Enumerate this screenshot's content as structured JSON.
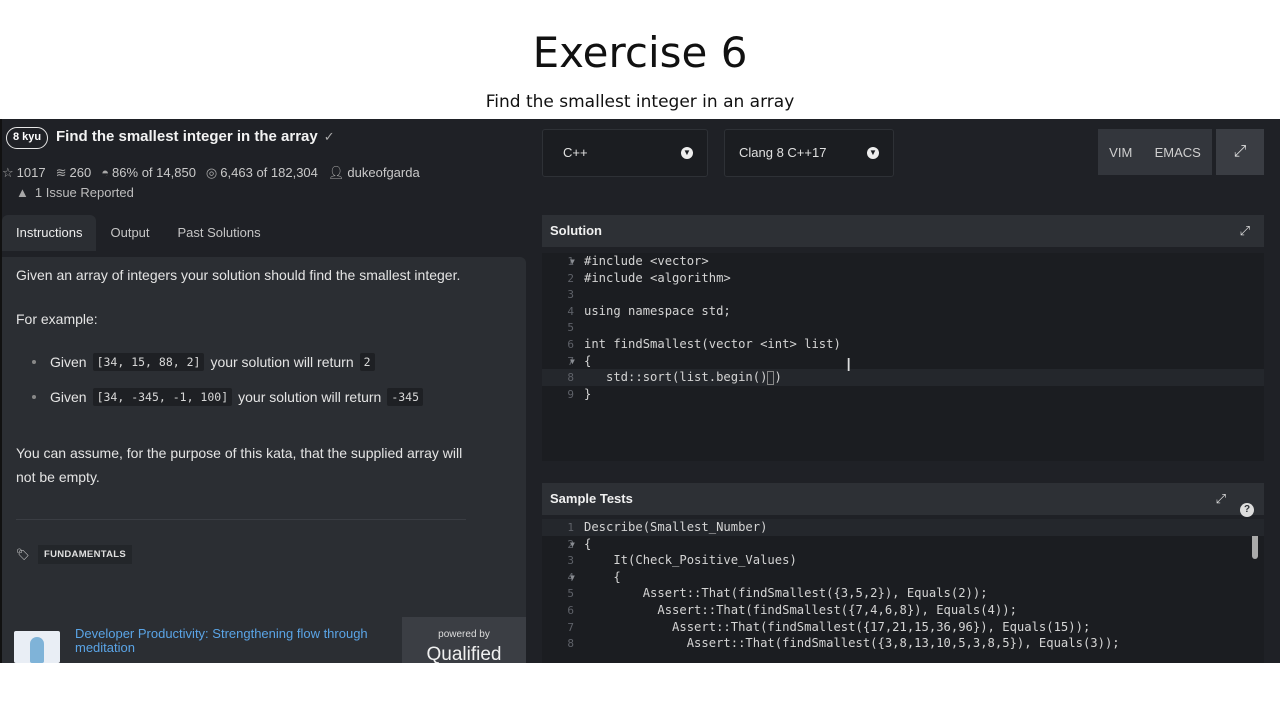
{
  "slide": {
    "title": "Exercise 6",
    "subtitle": "Find the smallest integer in an array"
  },
  "kata": {
    "rank": "8 kyu",
    "title": "Find the smallest integer in the array",
    "check": "✓",
    "stats": {
      "stars": "1017",
      "collections": "260",
      "satisfaction": "86%",
      "satisfaction_of": "of 14,850",
      "completed": "6,463",
      "completed_of": "of 182,304",
      "author": "dukeofgarda"
    },
    "issues": "1 Issue Reported"
  },
  "tabs": [
    "Instructions",
    "Output",
    "Past Solutions"
  ],
  "description": {
    "intro": "Given an array of integers your solution should find the smallest integer.",
    "for_example": "For example:",
    "bullets": [
      {
        "given": "Given",
        "code": "[34, 15, 88, 2]",
        "middle": "your solution will return",
        "result": "2"
      },
      {
        "given": "Given",
        "code": "[34, -345, -1, 100]",
        "middle": "your solution will return",
        "result": "-345"
      }
    ],
    "assume_line1": "You can assume, for the purpose of this kata, that the supplied array will",
    "assume_line2": "not be empty.",
    "tag": "FUNDAMENTALS"
  },
  "promo": {
    "title": "Developer Productivity: Strengthening flow through meditation",
    "subtitle": "",
    "powered_by": "powered by",
    "brand": "Qualified"
  },
  "editor": {
    "language": "C++",
    "version": "Clang 8 C++17",
    "modes": [
      "VIM",
      "EMACS"
    ],
    "solution_title": "Solution",
    "tests_title": "Sample Tests"
  },
  "solution_lines": [
    {
      "n": "1",
      "fold": true,
      "text": "#include <vector>"
    },
    {
      "n": "2",
      "fold": false,
      "text": "#include <algorithm>"
    },
    {
      "n": "3",
      "fold": false,
      "text": ""
    },
    {
      "n": "4",
      "fold": false,
      "text": "using namespace std;"
    },
    {
      "n": "5",
      "fold": false,
      "text": ""
    },
    {
      "n": "6",
      "fold": false,
      "text": "int findSmallest(vector <int> list)"
    },
    {
      "n": "7",
      "fold": true,
      "text": "{"
    },
    {
      "n": "8",
      "fold": false,
      "text": "   std::sort(list.begin()"
    },
    {
      "n": "9",
      "fold": false,
      "text": "}"
    }
  ],
  "test_lines": [
    {
      "n": "1",
      "fold": false,
      "text": "Describe(Smallest_Number)"
    },
    {
      "n": "2",
      "fold": true,
      "text": "{"
    },
    {
      "n": "3",
      "fold": false,
      "text": "    It(Check_Positive_Values)"
    },
    {
      "n": "4",
      "fold": true,
      "text": "    {"
    },
    {
      "n": "5",
      "fold": false,
      "text": "        Assert::That(findSmallest({3,5,2}), Equals(2));"
    },
    {
      "n": "6",
      "fold": false,
      "text": "          Assert::That(findSmallest({7,4,6,8}), Equals(4));"
    },
    {
      "n": "7",
      "fold": false,
      "text": "            Assert::That(findSmallest({17,21,15,36,96}), Equals(15));"
    },
    {
      "n": "8",
      "fold": false,
      "text": "              Assert::That(findSmallest({3,8,13,10,5,3,8,5}), Equals(3));"
    }
  ]
}
